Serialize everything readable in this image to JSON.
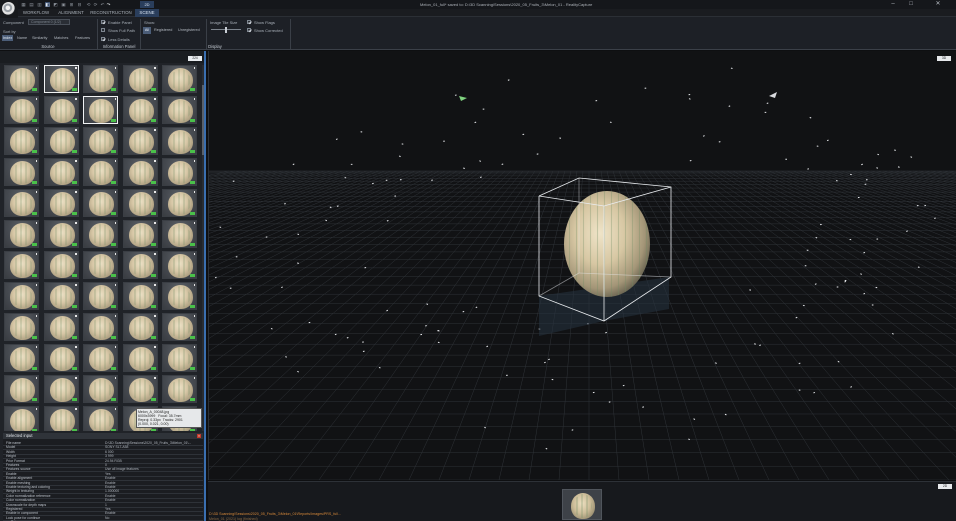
{
  "window": {
    "title": "Melon_01_full* saved to: D:\\3D Scanning\\Sessions\\2020_05_Fruits_3\\Melon_01 - RealityCapture",
    "minimize": "–",
    "maximize": "□",
    "close": "✕"
  },
  "quick_toolbar": [
    "▦",
    "▤",
    "▥",
    "◧",
    "◩",
    "▣",
    "⊞",
    "⊟",
    "⟲",
    "⟳",
    "↶",
    "↷"
  ],
  "tabs": [
    {
      "label": "WORKFLOW"
    },
    {
      "label": "ALIGNMENT"
    },
    {
      "label": "RECONSTRUCTION"
    },
    {
      "label": "SCENE"
    }
  ],
  "active_tab_marker": "2D",
  "ribbon": {
    "component_label": "Component",
    "component_placeholder": "Component 0 (1/2)",
    "sort_by_label": "Sort by",
    "sort_options": [
      "Index",
      "Name",
      "Similarity",
      "Matches",
      "Features"
    ],
    "sort_active": "Index",
    "source_title": "Source",
    "info_checks": [
      {
        "label": "Enable Panel",
        "checked": true
      },
      {
        "label": "Show Full Path",
        "checked": false
      },
      {
        "label": "Less Details",
        "checked": true
      }
    ],
    "info_title": "Information Panel",
    "show_label": "Show:",
    "show_options": [
      "All",
      "Registered",
      "Unregistered"
    ],
    "show_active": "All",
    "tile_size_label": "Image Tile Size",
    "tile_size_value": 0.5,
    "display_checks": [
      {
        "label": "Show Flags",
        "checked": true
      },
      {
        "label": "Show Corrected",
        "checked": true
      }
    ],
    "display_title": "Display"
  },
  "left_panel": {
    "badge": "224",
    "tooltip": {
      "line1": "Melon_A_00048.jpg",
      "line2a": "6000x3999",
      "line2b": "Focal: 35.7mm",
      "line3a": "Reproj: 0.33px",
      "line3b": "Tracks: 2901",
      "line4": "(0.000, 0.021, 0.00)"
    }
  },
  "selected_input": {
    "title": "Selected input",
    "close": "×",
    "rows": [
      {
        "k": "File name",
        "v": "D:\\3D Scanning\\Sessions\\2020_05_Fruits_3\\Melon_01\\..."
      },
      {
        "k": "Model",
        "v": "SONY SLT-A58"
      },
      {
        "k": "Width",
        "v": "6 000"
      },
      {
        "k": "Height",
        "v": "3 999"
      },
      {
        "k": "Prior Format",
        "v": "24.94 RGB"
      },
      {
        "k": "Features",
        "v": "0"
      },
      {
        "k": "Features source",
        "v": "Use all image features"
      },
      {
        "k": "Enable",
        "v": "Yes"
      },
      {
        "k": "Enable alignment",
        "v": "Enable"
      },
      {
        "k": "Enable meshing",
        "v": "Enable"
      },
      {
        "k": "Enable texturing and coloring",
        "v": "Enable"
      },
      {
        "k": "Weight in texturing",
        "v": "1.000000"
      },
      {
        "k": "Color normalization reference",
        "v": "Enable"
      },
      {
        "k": "Color normalization",
        "v": "Enable"
      },
      {
        "k": "Downscale for depth maps",
        "v": "1"
      },
      {
        "k": "Registered",
        "v": "Yes"
      },
      {
        "k": "Enable in component",
        "v": "Enable"
      },
      {
        "k": "Lock pose for continue",
        "v": "No"
      }
    ],
    "groups": [
      {
        "label": "Prior pose"
      },
      {
        "label": "Prior calibration"
      },
      {
        "label": "Prior lens distortion"
      },
      {
        "label": "Registration calibration"
      }
    ]
  },
  "viewport": {
    "badge": "3D",
    "bottom_badge": "2D"
  },
  "log": [
    "D:\\3D Scanning\\Sessions\\2020_05_Fruits_3\\Melon_01\\Reports\\Images\\PRS_full...",
    "Melon_01 (2021) log (finished)"
  ]
}
